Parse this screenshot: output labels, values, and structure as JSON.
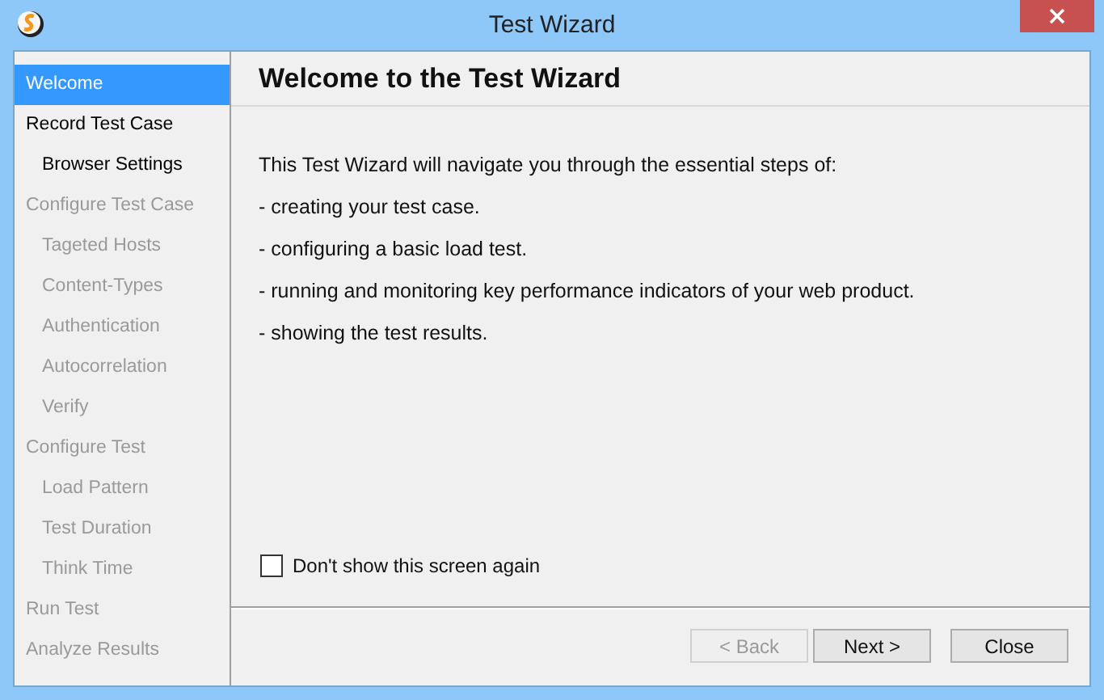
{
  "window": {
    "title": "Test Wizard"
  },
  "sidebar": {
    "items": [
      {
        "label": "Welcome",
        "selected": true,
        "disabled": false
      },
      {
        "label": "Record Test Case",
        "selected": false,
        "disabled": false,
        "children": [
          {
            "label": "Browser Settings",
            "selected": false,
            "disabled": false
          }
        ]
      },
      {
        "label": "Configure Test Case",
        "selected": false,
        "disabled": true,
        "children": [
          {
            "label": "Tageted Hosts",
            "selected": false,
            "disabled": true
          },
          {
            "label": "Content-Types",
            "selected": false,
            "disabled": true
          },
          {
            "label": "Authentication",
            "selected": false,
            "disabled": true
          },
          {
            "label": "Autocorrelation",
            "selected": false,
            "disabled": true
          },
          {
            "label": "Verify",
            "selected": false,
            "disabled": true
          }
        ]
      },
      {
        "label": "Configure Test",
        "selected": false,
        "disabled": true,
        "children": [
          {
            "label": "Load Pattern",
            "selected": false,
            "disabled": true
          },
          {
            "label": "Test Duration",
            "selected": false,
            "disabled": true
          },
          {
            "label": "Think Time",
            "selected": false,
            "disabled": true
          }
        ]
      },
      {
        "label": "Run Test",
        "selected": false,
        "disabled": true
      },
      {
        "label": "Analyze Results",
        "selected": false,
        "disabled": true
      }
    ]
  },
  "page": {
    "heading": "Welcome to the Test Wizard",
    "paragraphs": [
      "This Test Wizard will navigate you through the essential steps of:",
      "- creating your test case.",
      "- configuring a basic load test.",
      "- running and monitoring key performance indicators of your web product.",
      "- showing the test results."
    ]
  },
  "checkbox": {
    "label": "Don't show this screen again",
    "checked": false
  },
  "buttons": [
    {
      "label": "< Back",
      "disabled": true
    },
    {
      "label": "Next >",
      "disabled": false
    },
    {
      "label": "Close",
      "disabled": false
    }
  ]
}
